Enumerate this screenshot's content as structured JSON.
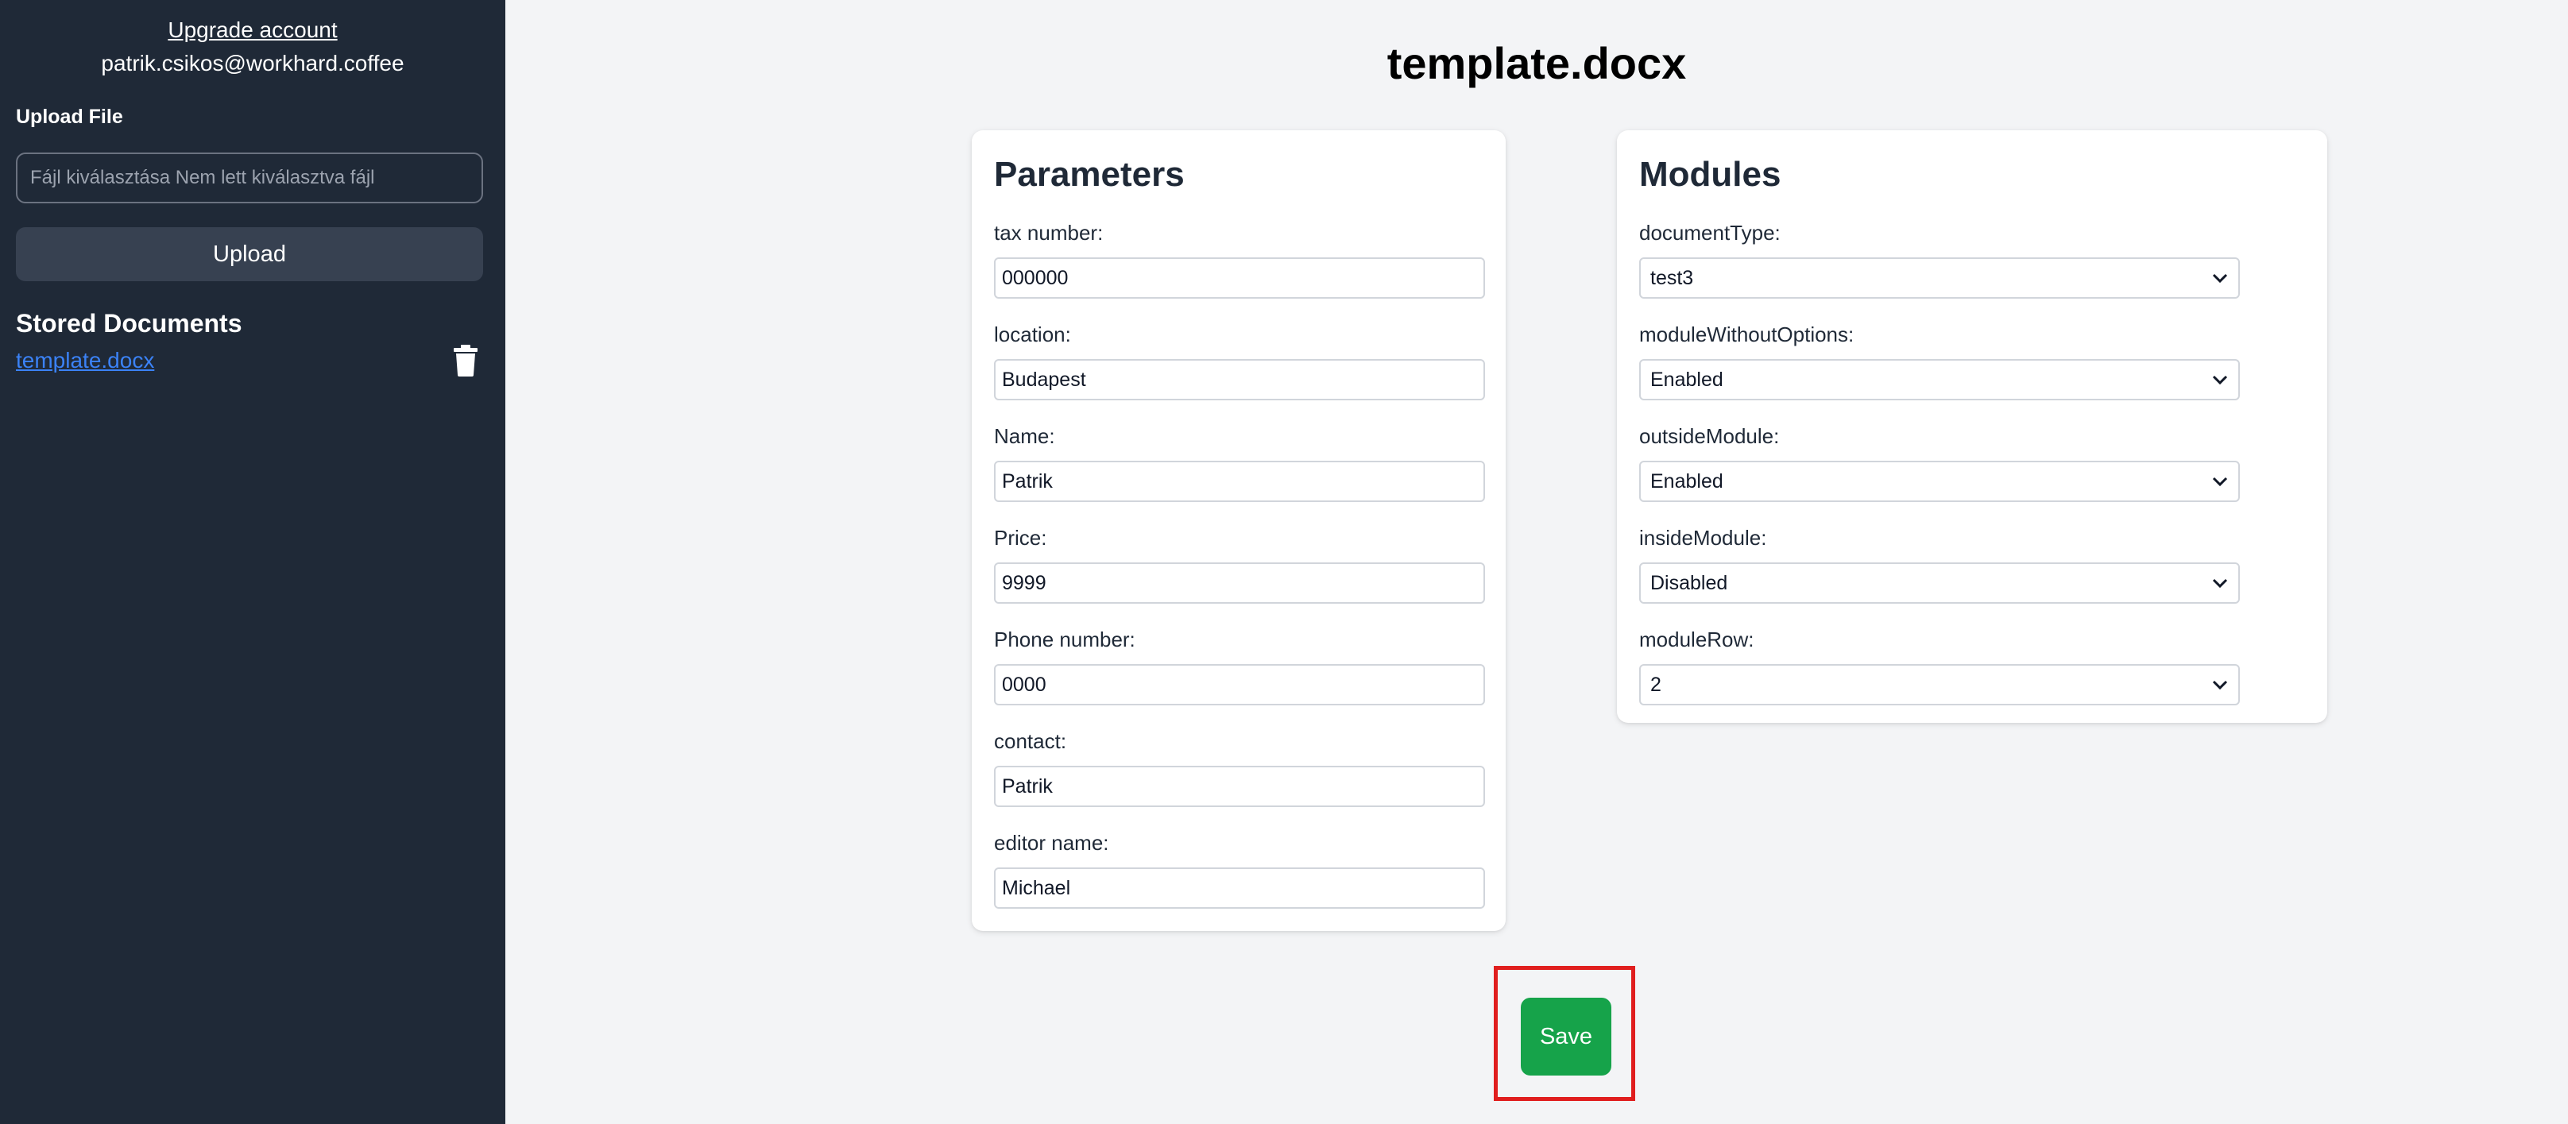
{
  "sidebar": {
    "upgrade_link": "Upgrade account",
    "user_email": "patrik.csikos@workhard.coffee",
    "upload_heading": "Upload File",
    "file_input_text": "Fájl kiválasztása Nem lett kiválasztva fájl",
    "upload_button": "Upload",
    "stored_heading": "Stored Documents",
    "documents": [
      {
        "name": "template.docx",
        "icon": "trash-icon"
      }
    ]
  },
  "main": {
    "title": "template.docx",
    "parameters": {
      "title": "Parameters",
      "fields": [
        {
          "label": "tax number:",
          "value": "000000"
        },
        {
          "label": "location:",
          "value": "Budapest"
        },
        {
          "label": "Name:",
          "value": "Patrik"
        },
        {
          "label": "Price:",
          "value": "9999"
        },
        {
          "label": "Phone number:",
          "value": "0000"
        },
        {
          "label": "contact:",
          "value": "Patrik"
        },
        {
          "label": "editor name:",
          "value": "Michael"
        }
      ]
    },
    "modules": {
      "title": "Modules",
      "fields": [
        {
          "label": "documentType:",
          "value": "test3"
        },
        {
          "label": "moduleWithoutOptions:",
          "value": "Enabled"
        },
        {
          "label": "outsideModule:",
          "value": "Enabled"
        },
        {
          "label": "insideModule:",
          "value": "Disabled"
        },
        {
          "label": "moduleRow:",
          "value": "2"
        }
      ]
    },
    "save_button": "Save"
  },
  "colors": {
    "sidebar_bg": "#1f2937",
    "page_bg": "#f3f4f6",
    "save_green": "#16a34a",
    "highlight_red": "#e01e1e",
    "link_blue": "#3b82f6"
  }
}
